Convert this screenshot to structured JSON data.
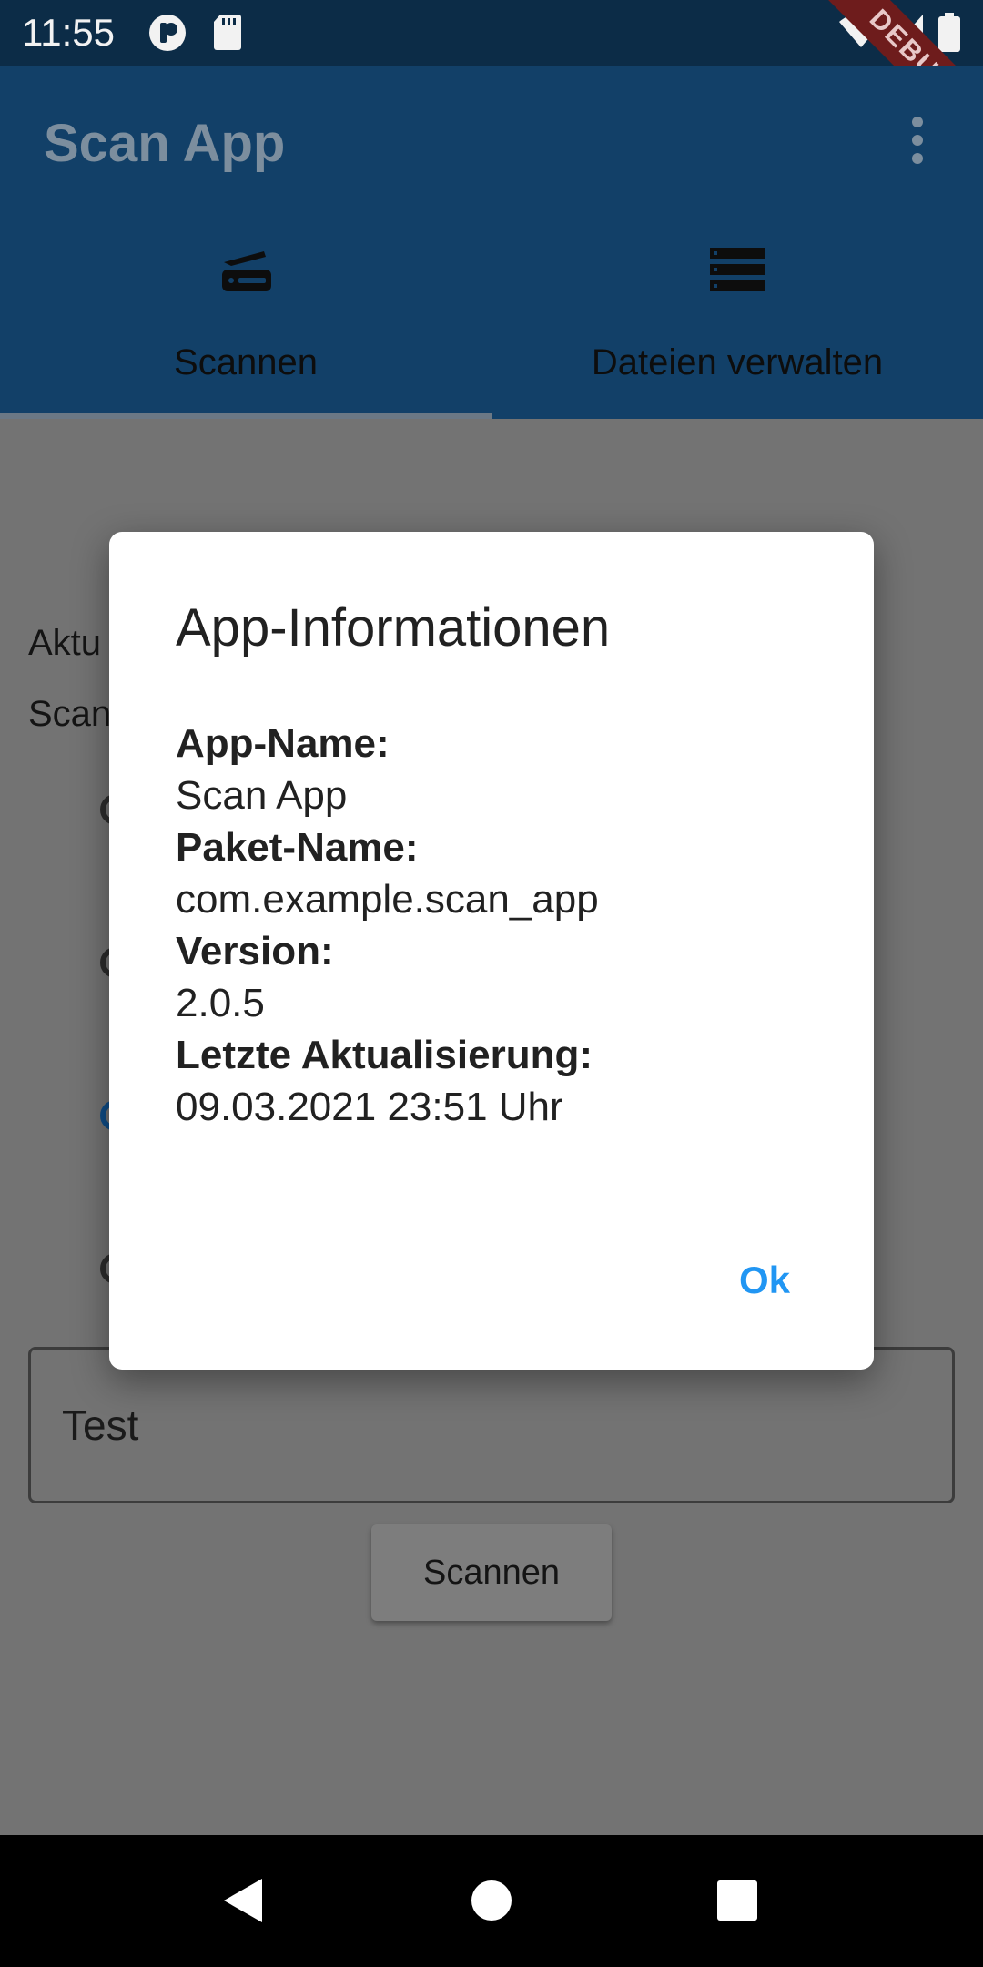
{
  "status_bar": {
    "time": "11:55"
  },
  "debug_banner": "DEBUG",
  "app_bar": {
    "title": "Scan App",
    "tabs": [
      {
        "label": "Scannen",
        "icon": "scanner-icon"
      },
      {
        "label": "Dateien verwalten",
        "icon": "list-icon"
      }
    ]
  },
  "background": {
    "line1": "Aktu",
    "line2": "Scan",
    "text_field_value": "Test",
    "scan_button": "Scannen"
  },
  "dialog": {
    "title": "App-Informationen",
    "app_name_label": "App-Name:",
    "app_name": "Scan App",
    "package_label": "Paket-Name:",
    "package": "com.example.scan_app",
    "version_label": "Version:",
    "version": "2.0.5",
    "update_label": "Letzte Aktualisierung:",
    "update": "09.03.2021 23:51 Uhr",
    "ok_label": "Ok"
  },
  "colors": {
    "accent": "#2196f3",
    "app_bar": "#124068"
  }
}
